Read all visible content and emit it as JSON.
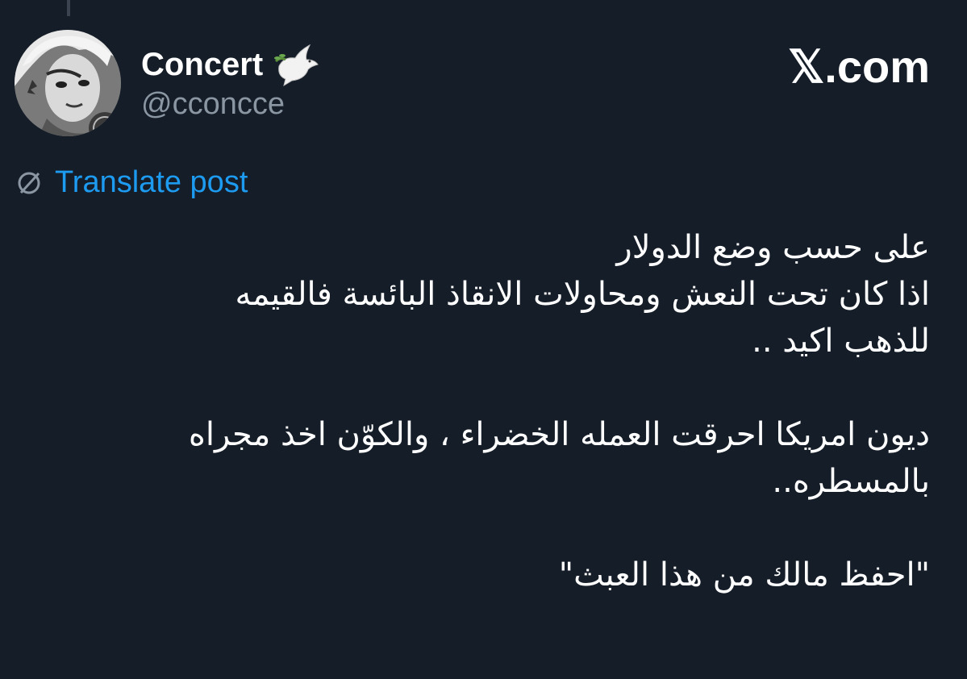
{
  "author": {
    "display_name": "Concert",
    "handle": "@cconcce",
    "badge_icon": "dove-icon"
  },
  "brand": "𝕏.com",
  "translate": {
    "label": "Translate post",
    "icon": "globe-icon",
    "color": "#1d9bf0"
  },
  "post": {
    "paragraphs": [
      [
        "على حسب وضع الدولار",
        "اذا كان تحت النعش ومحاولات الانقاذ البائسة فالقيمه",
        "للذهب اكيد .."
      ],
      [
        "ديون امريكا احرقت العمله الخضراء ، والكوّن اخذ مجراه",
        "بالمسطره.."
      ],
      [
        "\"احفظ مالك من هذا العبث\""
      ]
    ]
  },
  "colors": {
    "background": "#151d28",
    "text": "#ffffff",
    "secondary": "#8b96a3",
    "link": "#1d9bf0"
  }
}
